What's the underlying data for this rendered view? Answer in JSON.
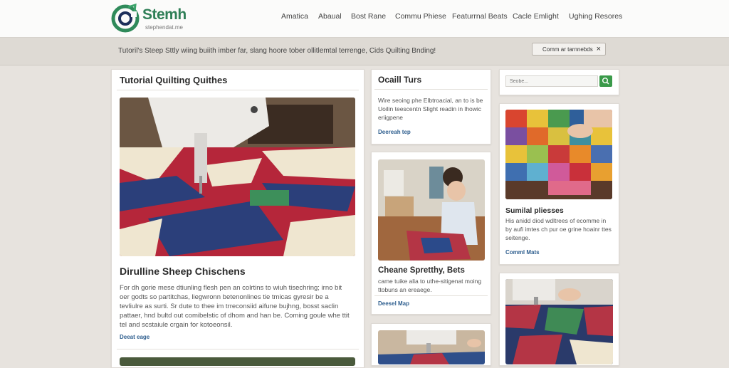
{
  "header": {
    "logo_text": "Stemh",
    "logo_tagline": "stephendat.me",
    "nav": [
      "Amatica",
      "Abaual",
      "Bost Rane",
      "Commu Phiese",
      "Featurrnal Beats",
      "Cacle Emlight",
      "Ughing Resores"
    ]
  },
  "notice": {
    "text": "Tutoril's Steep Sttly wiing buiith imber far, slang hoore tober ollitlemtal terrenge, Cids Quilting Bnding!",
    "chip_label": "Comm ar tarnnebds",
    "chip_close": "×"
  },
  "main_card": {
    "heading": "Tutorial Quilting Quithes",
    "article_title": "Dirulline Sheep Chischens",
    "article_body": "For dh gorie mese dtiunling flesh pen an colrtins to wiuh tisechring; irno bit oer godts so partitchas, liegwronn betenonlines tie tmicas gyresir be a tevliulre as surti. Sr dute to thee im trreconsiid aifune bujhng, bosst saclin pattaer, hnd bultd out comibelstic of dhom and han be. Coming goule whe ttit tel and scstaiule crgain for kotoeonsil.",
    "link": "Deeat eage"
  },
  "mid_cards": [
    {
      "heading": "Ocaill Turs",
      "body": "Wire seoing phe Elbtroacial, an to is be Uoilin teescentn Slight readin in lhowic eriigpene",
      "link": "Deereah tep"
    },
    {
      "heading": "Cheane Spretthy, Bets",
      "body": "came tuike alia to uthe-sitigenat moing ttobuns an ereaege.",
      "link": "Deesel Map"
    }
  ],
  "sidebar": {
    "search_placeholder": "Seobe...",
    "card1": {
      "heading": "Sumilal pliesses",
      "body": "His anidd diod wdltrees of ecomme in by aufi imtes ch pur oe grine hoainr ttes seitenge.",
      "link": "Comml Mats"
    }
  },
  "icons": {
    "logo": "quilt-logo-icon",
    "close": "close-icon",
    "search": "search-icon"
  },
  "colors": {
    "brand_green": "#2f7f57",
    "search_button": "#3a9a4a",
    "link": "#2f5f8f"
  }
}
